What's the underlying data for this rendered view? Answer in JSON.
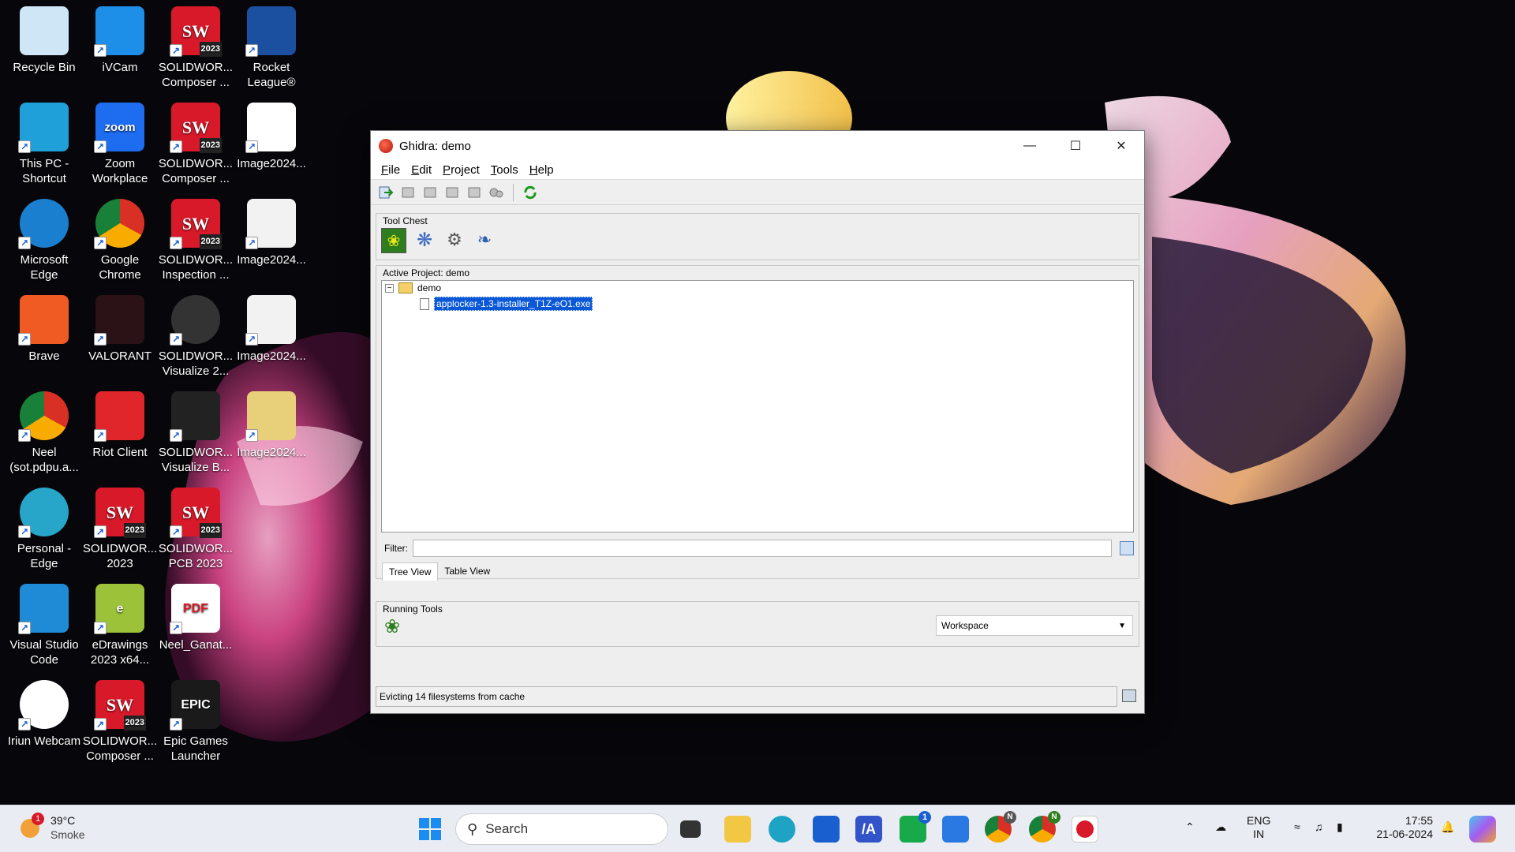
{
  "desktop": {
    "icons": [
      {
        "label": "Recycle Bin"
      },
      {
        "label": "iVCam"
      },
      {
        "label": "SOLIDWOR... Composer ..."
      },
      {
        "label": "Rocket League®"
      },
      {
        "label": "This PC - Shortcut"
      },
      {
        "label": "Zoom Workplace"
      },
      {
        "label": "SOLIDWOR... Composer ..."
      },
      {
        "label": "Image2024..."
      },
      {
        "label": "Microsoft Edge"
      },
      {
        "label": "Google Chrome"
      },
      {
        "label": "SOLIDWOR... Inspection ..."
      },
      {
        "label": "Image2024..."
      },
      {
        "label": "Brave"
      },
      {
        "label": "VALORANT"
      },
      {
        "label": "SOLIDWOR... Visualize 2..."
      },
      {
        "label": "Image2024..."
      },
      {
        "label": "Neel (sot.pdpu.a..."
      },
      {
        "label": "Riot Client"
      },
      {
        "label": "SOLIDWOR... Visualize B..."
      },
      {
        "label": "Image2024..."
      },
      {
        "label": "Personal - Edge"
      },
      {
        "label": "SOLIDWOR... 2023"
      },
      {
        "label": "SOLIDWOR... PCB 2023"
      },
      {
        "label": "Visual Studio Code"
      },
      {
        "label": "eDrawings 2023 x64..."
      },
      {
        "label": "Neel_Ganat..."
      },
      {
        "label": "Iriun Webcam"
      },
      {
        "label": "SOLIDWOR... Composer ..."
      },
      {
        "label": "Epic Games Launcher"
      }
    ],
    "icon_glyphs": {
      "sw_year": "2023",
      "zoom": "zoom",
      "pdf": "PDF",
      "epic": "EPIC",
      "edrawings": "e"
    }
  },
  "window": {
    "title": "Ghidra: demo",
    "menu": [
      {
        "label": "File",
        "key": "F",
        "rest": "ile"
      },
      {
        "label": "Edit",
        "key": "E",
        "rest": "dit"
      },
      {
        "label": "Project",
        "key": "P",
        "rest": "roject"
      },
      {
        "label": "Tools",
        "key": "T",
        "rest": "ools"
      },
      {
        "label": "Help",
        "key": "H",
        "rest": "elp"
      }
    ],
    "tool_chest_title": "Tool Chest",
    "active_project_title": "Active Project: demo",
    "tree": {
      "root": "demo",
      "child": "applocker-1.3-installer_T1Z-eO1.exe"
    },
    "filter_label": "Filter:",
    "tabs": [
      "Tree View",
      "Table View"
    ],
    "running_tools_title": "Running Tools",
    "workspace_option": "Workspace",
    "status_text": "Evicting 14 filesystems from cache"
  },
  "taskbar": {
    "weather_temp": "39°C",
    "weather_desc": "Smoke",
    "weather_badge": "1",
    "search_placeholder": "Search",
    "lang_top": "ENG",
    "lang_bottom": "IN",
    "time": "17:55",
    "date": "21-06-2024",
    "app_badges": {
      "xbox": "1",
      "chrome1": "N",
      "chrome2": "N"
    }
  },
  "colors": {
    "accent": "#0a58d8",
    "taskbar": "#e9edf3",
    "window_bg": "#eeeeee"
  }
}
